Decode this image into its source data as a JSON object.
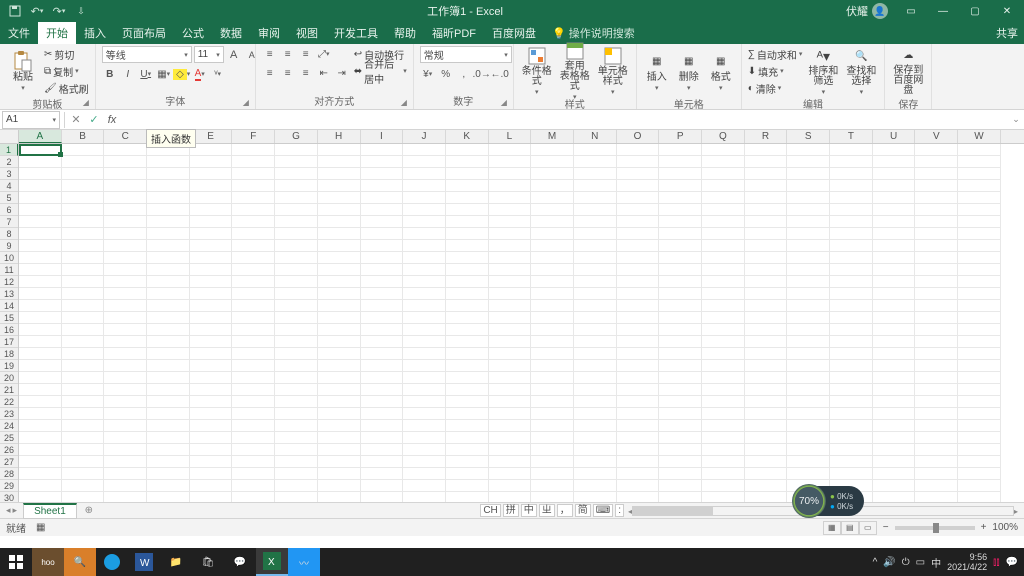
{
  "title_bar": {
    "app_title": "工作簿1 - Excel",
    "user_name": "伏耀",
    "qat": {
      "save": "save-icon",
      "undo": "undo-icon",
      "redo": "redo-icon"
    },
    "win": {
      "ribbon_opts": "▭",
      "minimize": "—",
      "maximize": "▢",
      "close": "✕"
    }
  },
  "menu": {
    "items": [
      "文件",
      "开始",
      "插入",
      "页面布局",
      "公式",
      "数据",
      "审阅",
      "视图",
      "开发工具",
      "帮助",
      "福昕PDF",
      "百度网盘"
    ],
    "active_index": 1,
    "tell_me": "操作说明搜索",
    "share": "共享"
  },
  "ribbon": {
    "clipboard": {
      "paste": "粘贴",
      "cut": "剪切",
      "copy": "复制",
      "format_painter": "格式刷",
      "group": "剪贴板"
    },
    "font": {
      "name": "等线",
      "size": "11",
      "increase": "A",
      "decrease": "A",
      "bold": "B",
      "italic": "I",
      "underline": "U",
      "group": "字体"
    },
    "align": {
      "wrap": "自动换行",
      "merge": "合并后居中",
      "group": "对齐方式"
    },
    "number": {
      "format": "常规",
      "group": "数字"
    },
    "styles": {
      "cond": "条件格式",
      "table": "套用\n表格格式",
      "cell": "单元格样式",
      "group": "样式"
    },
    "cells": {
      "insert": "插入",
      "delete": "删除",
      "format": "格式",
      "group": "单元格"
    },
    "editing": {
      "sum": "自动求和",
      "fill": "填充",
      "clear": "清除",
      "sort": "排序和筛选",
      "find": "查找和选择",
      "group": "编辑"
    },
    "save": {
      "baidu": "保存到\n百度网盘",
      "group": "保存"
    }
  },
  "formula_bar": {
    "cell_ref": "A1",
    "cancel": "✕",
    "enter": "✓",
    "fx": "fx",
    "fx_tooltip": "插入函数",
    "formula": "",
    "expand": "⌄"
  },
  "grid": {
    "columns": [
      "A",
      "B",
      "C",
      "D",
      "E",
      "F",
      "G",
      "H",
      "I",
      "J",
      "K",
      "L",
      "M",
      "N",
      "O",
      "P",
      "Q",
      "R",
      "S",
      "T",
      "U",
      "V",
      "W"
    ],
    "rows": [
      1,
      2,
      3,
      4,
      5,
      6,
      7,
      8,
      9,
      10,
      11,
      12,
      13,
      14,
      15,
      16,
      17,
      18,
      19,
      20,
      21,
      22,
      23,
      24,
      25,
      26,
      27,
      28,
      29,
      30
    ],
    "active": "A1"
  },
  "sheet_bar": {
    "sheet1": "Sheet1",
    "add": "⊕",
    "ime": [
      "CH",
      "拼",
      "中",
      "ㄓ",
      "，",
      "简",
      "⌨",
      ":"
    ]
  },
  "status_bar": {
    "left": [
      "就绪",
      "▦"
    ],
    "zoom": "100%",
    "zoom_minus": "−",
    "zoom_plus": "+"
  },
  "gauge": {
    "pct": "70%",
    "s1": "0K/s",
    "s2": "0K/s"
  },
  "taskbar": {
    "time": "9:56",
    "date": "2021/4/22",
    "tray": [
      "^",
      "🔊",
      "⏻",
      "▭",
      "中"
    ]
  }
}
